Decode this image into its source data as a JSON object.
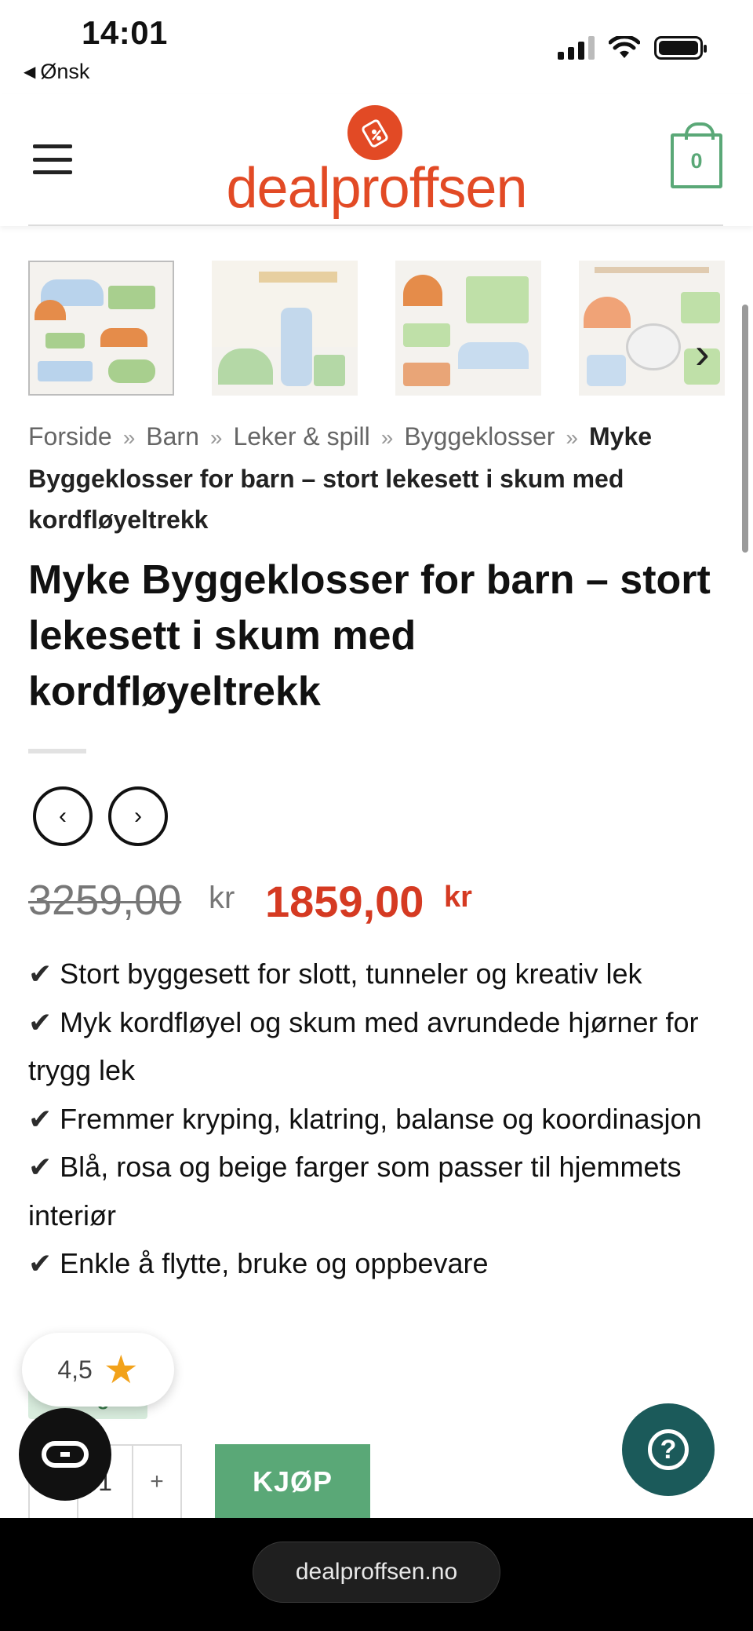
{
  "status_bar": {
    "time": "14:01",
    "back_label": "Ønsk"
  },
  "header": {
    "logo_text": "dealproffsen",
    "cart_count": "0",
    "brand_color": "#e24a25",
    "accent_color": "#5aa877"
  },
  "gallery": {
    "thumbnail_count": 4,
    "next_icon": "chevron-right-icon"
  },
  "breadcrumb": {
    "items": [
      "Forside",
      "Barn",
      "Leker & spill",
      "Byggeklosser"
    ],
    "separator": "»",
    "current": "Myke Byggeklosser for barn – stort lekesett i skum med kordfløyeltrekk"
  },
  "product": {
    "title": "Myke Byggeklosser for barn – stort lekesett i skum med kordfløyeltrekk",
    "old_price": "3259,00",
    "new_price": "1859,00",
    "currency": "kr",
    "features": [
      "Stort byggesett for slott, tunneler og kreativ lek",
      "Myk kordfløyel og skum med avrundede hjørner for trygg lek",
      "Fremmer kryping, klatring, balanse og koordinasjon",
      "Blå, rosa og beige farger som passer til hjemmets interiør",
      "Enkle å flytte, bruke og oppbevare"
    ],
    "check_mark": "✔",
    "stock_label": "lager"
  },
  "nav_buttons": {
    "prev": "‹",
    "next": "›"
  },
  "rating": {
    "value": "4,5",
    "star": "★"
  },
  "purchase": {
    "minus": "-",
    "quantity": "1",
    "plus": "+",
    "buy_label": "KJØP"
  },
  "help": {
    "icon_label": "?"
  },
  "browser": {
    "url": "dealproffsen.no"
  }
}
